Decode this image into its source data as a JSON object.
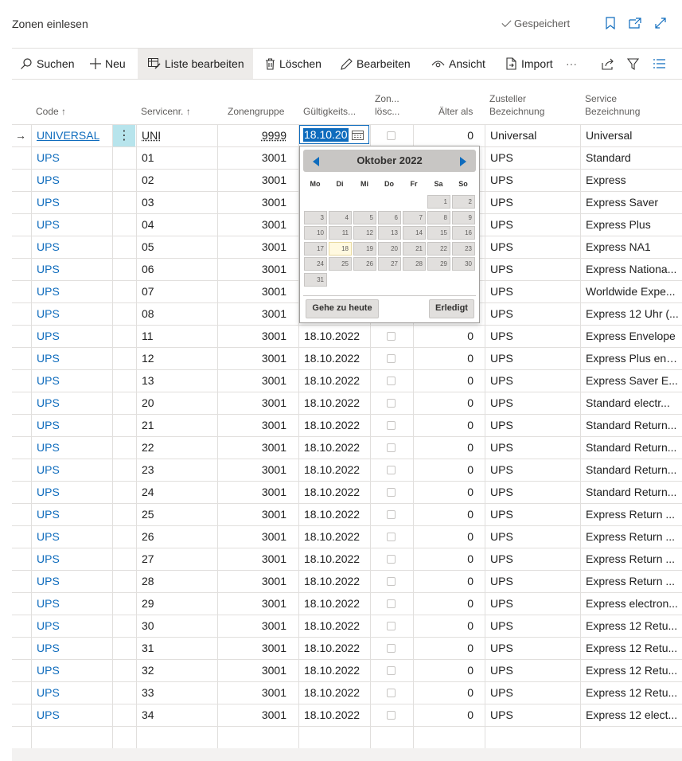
{
  "header": {
    "page_title": "Zonen einlesen",
    "saved_label": "Gespeichert"
  },
  "toolbar": {
    "search": "Suchen",
    "new": "Neu",
    "edit_list": "Liste bearbeiten",
    "delete": "Löschen",
    "edit": "Bearbeiten",
    "view": "Ansicht",
    "import": "Import",
    "more": "···"
  },
  "columns": {
    "code": "Code ↑",
    "service_nr": "Servicenr. ↑",
    "zone_group": "Zonengruppe",
    "validity": "Gültigkeits...",
    "zone_delete_1": "Zon...",
    "zone_delete_2": "lösc...",
    "older_than": "Älter als",
    "carrier_1": "Zusteller",
    "carrier_2": "Bezeichnung",
    "service_1": "Service",
    "service_2": "Bezeichnung"
  },
  "first_row": {
    "code": "UNIVERSAL",
    "service_nr": "UNI",
    "zone_group": "9999",
    "date_value": "18.10.20",
    "older_than": "0",
    "carrier": "Universal",
    "service": "Universal"
  },
  "rows": [
    {
      "code": "UPS",
      "nr": "01",
      "zg": "3001",
      "date": "",
      "older": "",
      "carrier": "UPS",
      "service": "Standard"
    },
    {
      "code": "UPS",
      "nr": "02",
      "zg": "3001",
      "date": "",
      "older": "",
      "carrier": "UPS",
      "service": "Express"
    },
    {
      "code": "UPS",
      "nr": "03",
      "zg": "3001",
      "date": "",
      "older": "",
      "carrier": "UPS",
      "service": "Express Saver"
    },
    {
      "code": "UPS",
      "nr": "04",
      "zg": "3001",
      "date": "",
      "older": "",
      "carrier": "UPS",
      "service": "Express Plus"
    },
    {
      "code": "UPS",
      "nr": "05",
      "zg": "3001",
      "date": "",
      "older": "",
      "carrier": "UPS",
      "service": "Express NA1"
    },
    {
      "code": "UPS",
      "nr": "06",
      "zg": "3001",
      "date": "",
      "older": "",
      "carrier": "UPS",
      "service": "Express Nationa..."
    },
    {
      "code": "UPS",
      "nr": "07",
      "zg": "3001",
      "date": "",
      "older": "",
      "carrier": "UPS",
      "service": "Worldwide Expe..."
    },
    {
      "code": "UPS",
      "nr": "08",
      "zg": "3001",
      "date": "",
      "older": "",
      "carrier": "UPS",
      "service": "Express 12 Uhr (..."
    },
    {
      "code": "UPS",
      "nr": "11",
      "zg": "3001",
      "date": "18.10.2022",
      "older": "0",
      "carrier": "UPS",
      "service": "Express Envelope"
    },
    {
      "code": "UPS",
      "nr": "12",
      "zg": "3001",
      "date": "18.10.2022",
      "older": "0",
      "carrier": "UPS",
      "service": "Express Plus env..."
    },
    {
      "code": "UPS",
      "nr": "13",
      "zg": "3001",
      "date": "18.10.2022",
      "older": "0",
      "carrier": "UPS",
      "service": "Express Saver E..."
    },
    {
      "code": "UPS",
      "nr": "20",
      "zg": "3001",
      "date": "18.10.2022",
      "older": "0",
      "carrier": "UPS",
      "service": "Standard electr..."
    },
    {
      "code": "UPS",
      "nr": "21",
      "zg": "3001",
      "date": "18.10.2022",
      "older": "0",
      "carrier": "UPS",
      "service": "Standard Return..."
    },
    {
      "code": "UPS",
      "nr": "22",
      "zg": "3001",
      "date": "18.10.2022",
      "older": "0",
      "carrier": "UPS",
      "service": "Standard Return..."
    },
    {
      "code": "UPS",
      "nr": "23",
      "zg": "3001",
      "date": "18.10.2022",
      "older": "0",
      "carrier": "UPS",
      "service": "Standard Return..."
    },
    {
      "code": "UPS",
      "nr": "24",
      "zg": "3001",
      "date": "18.10.2022",
      "older": "0",
      "carrier": "UPS",
      "service": "Standard Return..."
    },
    {
      "code": "UPS",
      "nr": "25",
      "zg": "3001",
      "date": "18.10.2022",
      "older": "0",
      "carrier": "UPS",
      "service": "Express Return ..."
    },
    {
      "code": "UPS",
      "nr": "26",
      "zg": "3001",
      "date": "18.10.2022",
      "older": "0",
      "carrier": "UPS",
      "service": "Express Return ..."
    },
    {
      "code": "UPS",
      "nr": "27",
      "zg": "3001",
      "date": "18.10.2022",
      "older": "0",
      "carrier": "UPS",
      "service": "Express Return ..."
    },
    {
      "code": "UPS",
      "nr": "28",
      "zg": "3001",
      "date": "18.10.2022",
      "older": "0",
      "carrier": "UPS",
      "service": "Express Return ..."
    },
    {
      "code": "UPS",
      "nr": "29",
      "zg": "3001",
      "date": "18.10.2022",
      "older": "0",
      "carrier": "UPS",
      "service": "Express electron..."
    },
    {
      "code": "UPS",
      "nr": "30",
      "zg": "3001",
      "date": "18.10.2022",
      "older": "0",
      "carrier": "UPS",
      "service": "Express 12 Retu..."
    },
    {
      "code": "UPS",
      "nr": "31",
      "zg": "3001",
      "date": "18.10.2022",
      "older": "0",
      "carrier": "UPS",
      "service": "Express 12 Retu..."
    },
    {
      "code": "UPS",
      "nr": "32",
      "zg": "3001",
      "date": "18.10.2022",
      "older": "0",
      "carrier": "UPS",
      "service": "Express 12 Retu..."
    },
    {
      "code": "UPS",
      "nr": "33",
      "zg": "3001",
      "date": "18.10.2022",
      "older": "0",
      "carrier": "UPS",
      "service": "Express 12 Retu..."
    },
    {
      "code": "UPS",
      "nr": "34",
      "zg": "3001",
      "date": "18.10.2022",
      "older": "0",
      "carrier": "UPS",
      "service": "Express 12 elect..."
    }
  ],
  "calendar": {
    "title": "Oktober 2022",
    "weekdays": [
      "Mo",
      "Di",
      "Mi",
      "Do",
      "Fr",
      "Sa",
      "So"
    ],
    "days": [
      "1",
      "2",
      "3",
      "4",
      "5",
      "6",
      "7",
      "8",
      "9",
      "10",
      "11",
      "12",
      "13",
      "14",
      "15",
      "16",
      "17",
      "18",
      "19",
      "20",
      "21",
      "22",
      "23",
      "24",
      "25",
      "26",
      "27",
      "28",
      "29",
      "30",
      "31"
    ],
    "first_weekday_index": 5,
    "today": "18",
    "today_button": "Gehe zu heute",
    "done_button": "Erledigt"
  },
  "colors": {
    "accent": "#0f6cbd",
    "selected_cell": "#b7e4ec",
    "today_bg": "#fff9e0"
  }
}
